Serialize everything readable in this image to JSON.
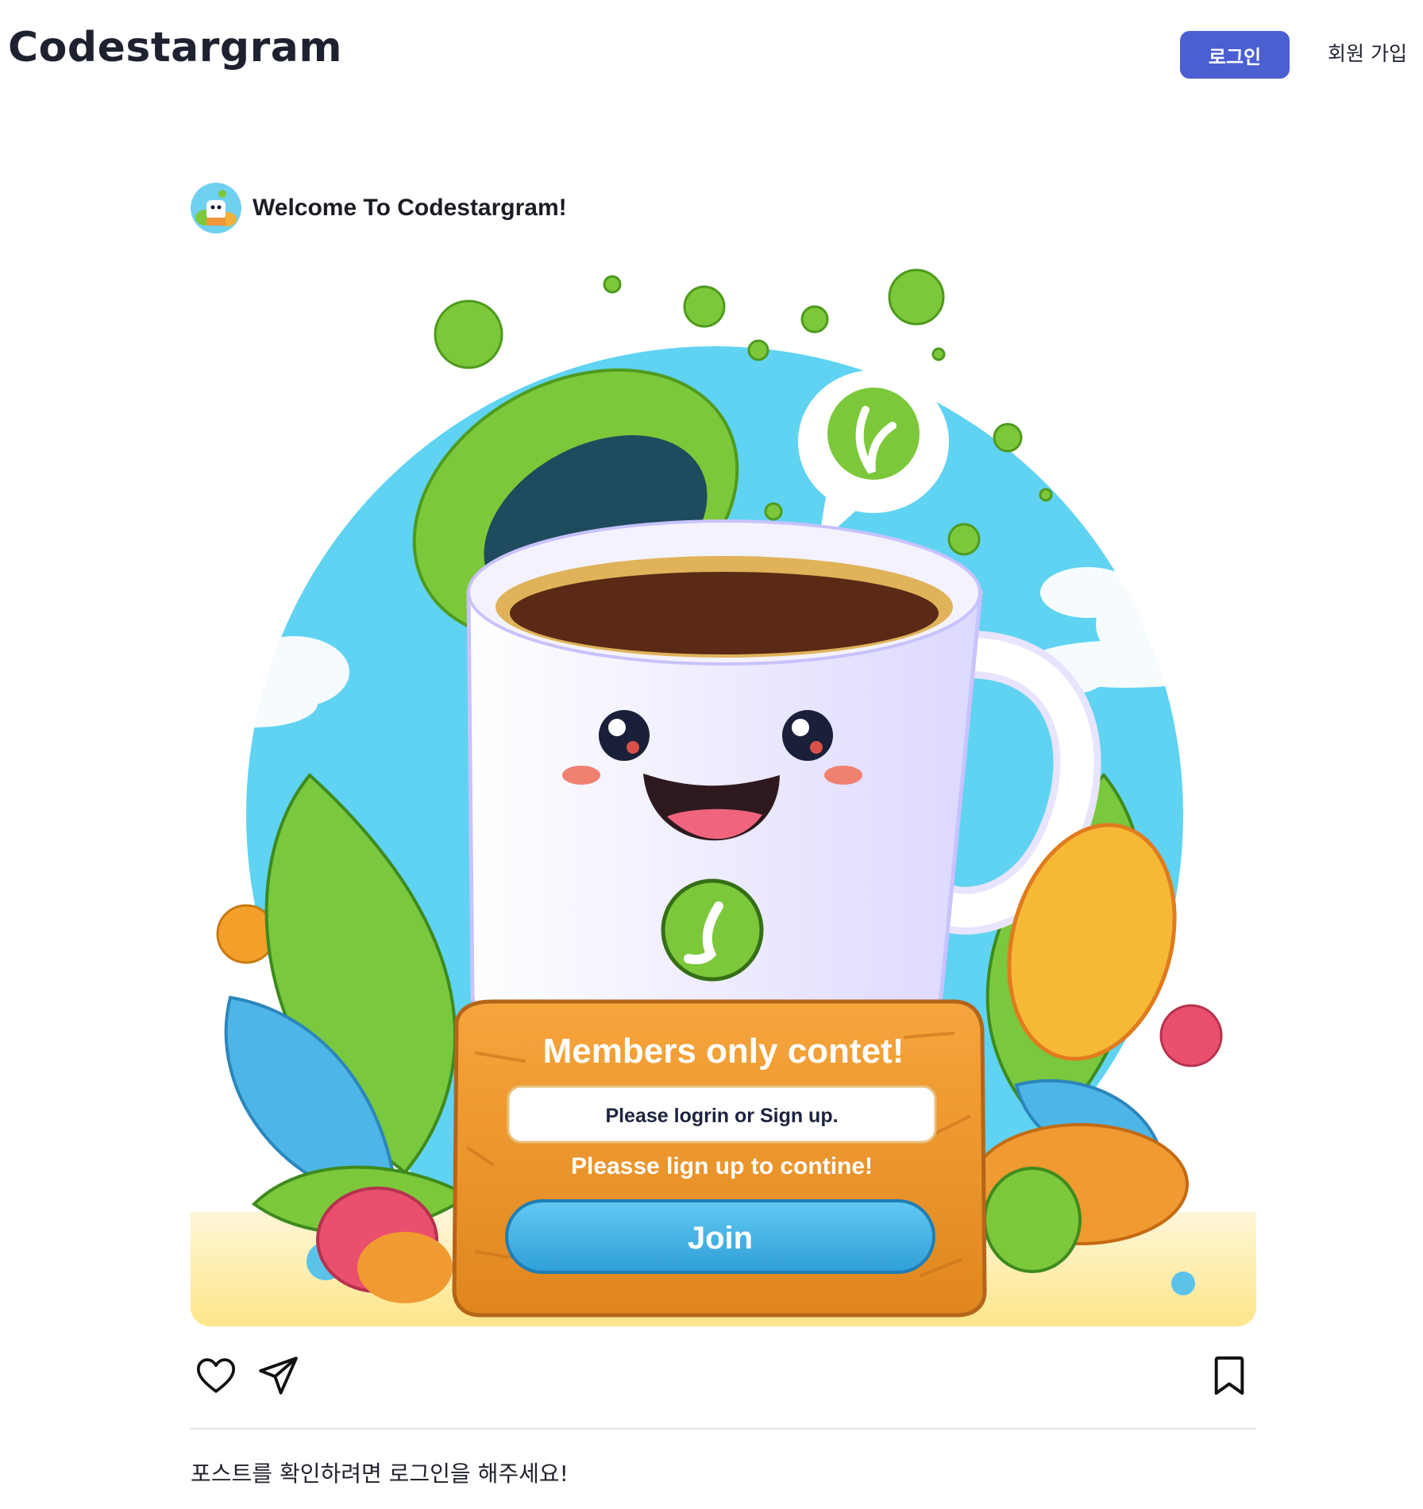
{
  "header": {
    "logo": "Codestargram",
    "login_label": "로그인",
    "signup_label": "회원 가입"
  },
  "post": {
    "author_title": "Welcome To Codestargram!",
    "image": {
      "sign_title": "Members only contet!",
      "field_text": "Please logrin or Sign up.",
      "subtitle": "Pleasse lign up to contine!",
      "button_label": "Join"
    },
    "actions": {
      "like_icon": "heart-icon",
      "share_icon": "send-icon",
      "bookmark_icon": "bookmark-icon"
    },
    "caption": "포스트를 확인하려면 로그인을 해주세요!"
  },
  "colors": {
    "accent": "#4a5fd0",
    "sky": "#5fd3f1",
    "green": "#7cc83a",
    "orange": "#f0a03c",
    "blue_button": "#45b6e6"
  }
}
